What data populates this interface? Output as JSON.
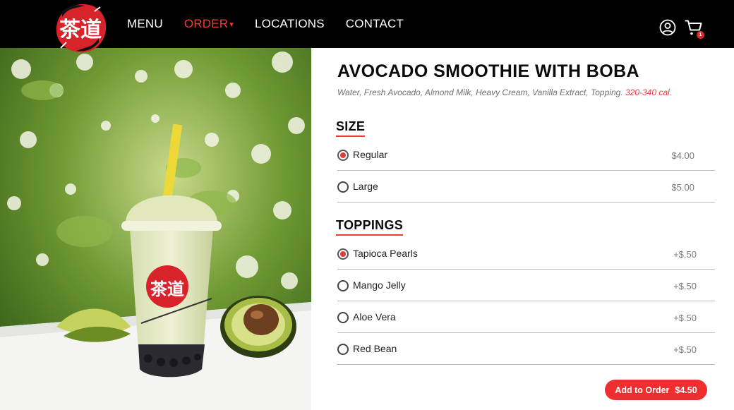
{
  "brand": {
    "logo_icon": "chadao-brush-calligraphy-logo",
    "logo_text": "茶道",
    "accent_color": "#ef3b3b",
    "nav_bg": "#000000"
  },
  "nav": {
    "items": [
      {
        "label": "MENU",
        "active": false
      },
      {
        "label": "ORDER",
        "active": true,
        "caret": "▾"
      },
      {
        "label": "LOCATIONS",
        "active": false
      },
      {
        "label": "CONTACT",
        "active": false
      }
    ],
    "user_icon": "user-circle-icon",
    "cart_icon": "shopping-cart-icon",
    "cart_count": "1"
  },
  "product": {
    "image_alt": "Avocado smoothie with boba in a branded cup next to a halved avocado",
    "title": "AVOCADO SMOOTHIE WITH BOBA",
    "description": "Water, Fresh Avocado, Almond Milk, Heavy Cream, Vanilla Extract, Topping.",
    "calories": "320-340 cal."
  },
  "size": {
    "heading": "SIZE",
    "options": [
      {
        "label": "Regular",
        "price": "$4.00",
        "selected": true
      },
      {
        "label": "Large",
        "price": "$5.00",
        "selected": false
      }
    ]
  },
  "toppings": {
    "heading": "TOPPINGS",
    "options": [
      {
        "label": "Tapioca Pearls",
        "price": "+$.50",
        "selected": true
      },
      {
        "label": "Mango Jelly",
        "price": "+$.50",
        "selected": false
      },
      {
        "label": "Aloe Vera",
        "price": "+$.50",
        "selected": false
      },
      {
        "label": "Red Bean",
        "price": "+$.50",
        "selected": false
      }
    ]
  },
  "cta": {
    "label": "Add to Order",
    "price": "$4.50"
  }
}
